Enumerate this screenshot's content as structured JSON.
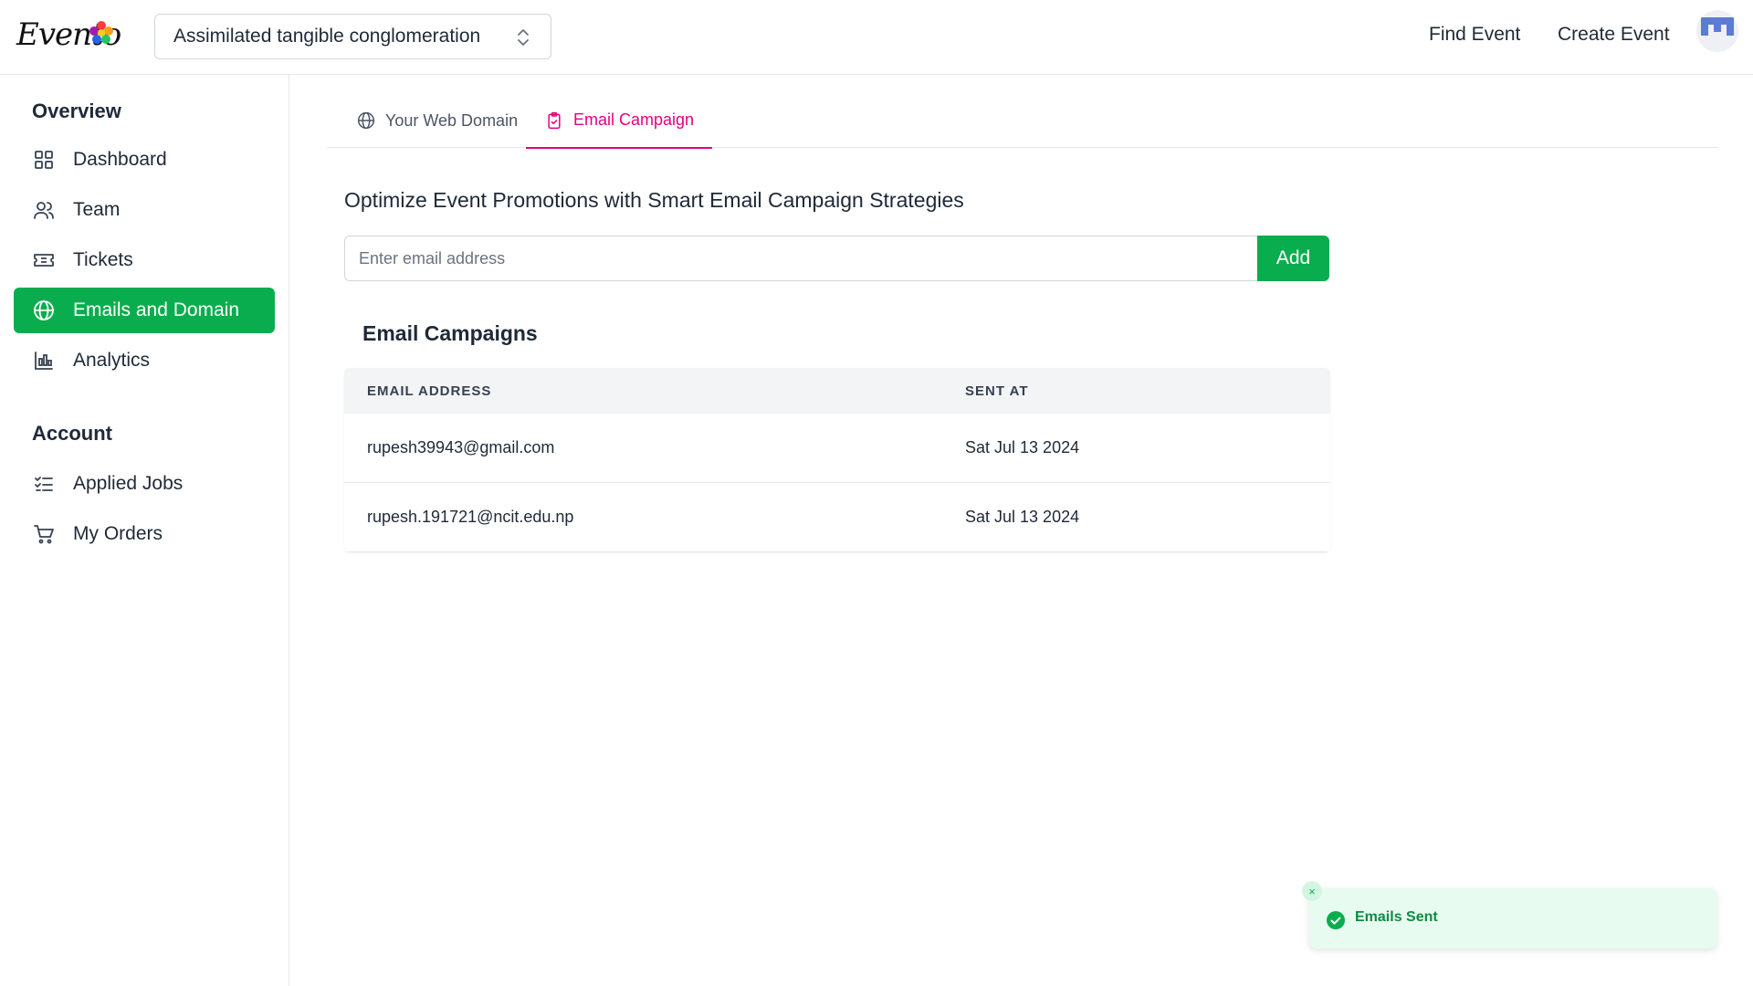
{
  "header": {
    "logo_text": "Evento",
    "org_selector": "Assimilated tangible conglomeration",
    "nav": {
      "find_event": "Find Event",
      "create_event": "Create Event"
    }
  },
  "sidebar": {
    "overview_title": "Overview",
    "overview_items": [
      {
        "label": "Dashboard",
        "icon": "grid-icon"
      },
      {
        "label": "Team",
        "icon": "users-icon"
      },
      {
        "label": "Tickets",
        "icon": "ticket-icon"
      },
      {
        "label": "Emails and Domain",
        "icon": "globe-icon",
        "active": true
      },
      {
        "label": "Analytics",
        "icon": "bar-chart-icon"
      }
    ],
    "account_title": "Account",
    "account_items": [
      {
        "label": "Applied Jobs",
        "icon": "checklist-icon"
      },
      {
        "label": "My Orders",
        "icon": "cart-icon"
      }
    ]
  },
  "tabs": {
    "web_domain": "Your Web Domain",
    "email_campaign": "Email Campaign"
  },
  "main": {
    "heading": "Optimize Event Promotions with Smart Email Campaign Strategies",
    "email_input_placeholder": "Enter email address",
    "add_button": "Add",
    "campaigns_title": "Email Campaigns",
    "table": {
      "columns": [
        "EMAIL ADDRESS",
        "SENT AT"
      ],
      "rows": [
        [
          "rupesh39943@gmail.com",
          "Sat Jul 13 2024"
        ],
        [
          "rupesh.191721@ncit.edu.np",
          "Sat Jul 13 2024"
        ]
      ]
    }
  },
  "toast": {
    "message": "Emails Sent",
    "close": "×"
  },
  "colors": {
    "accent_green": "#0aad4e",
    "active_tab_pink": "#e6007e"
  }
}
